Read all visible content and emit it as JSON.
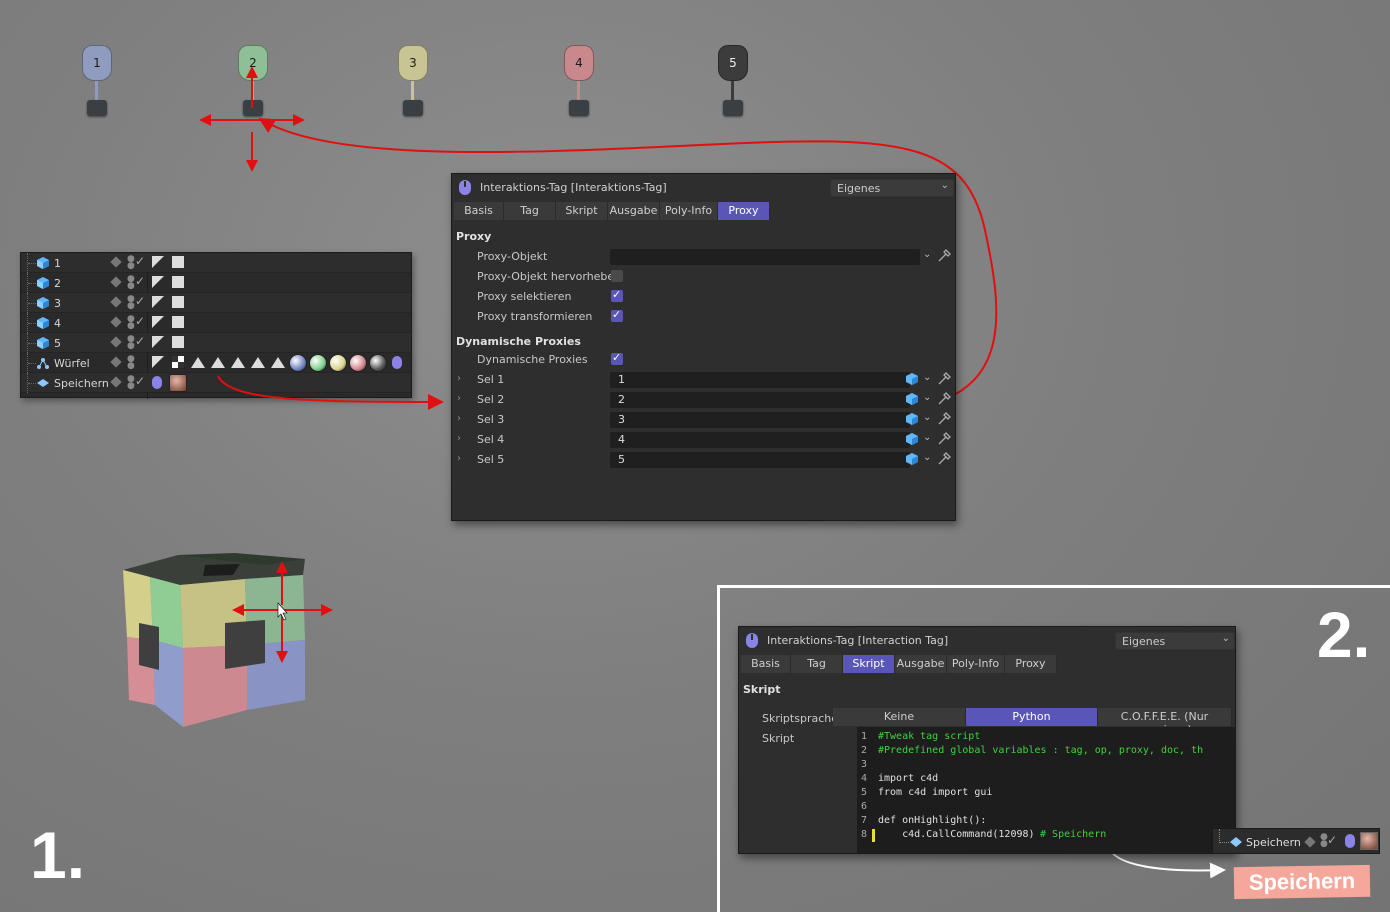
{
  "markers": [
    {
      "label": "1",
      "color": "#8f9cbf"
    },
    {
      "label": "2",
      "color": "#8fbf97"
    },
    {
      "label": "3",
      "color": "#c9c494"
    },
    {
      "label": "4",
      "color": "#c8888c"
    },
    {
      "label": "5",
      "color": "#3c3c3c"
    }
  ],
  "object_manager": {
    "rows": [
      {
        "name": "1"
      },
      {
        "name": "2"
      },
      {
        "name": "3"
      },
      {
        "name": "4"
      },
      {
        "name": "5"
      },
      {
        "name": "Würfel"
      },
      {
        "name": "Speichern"
      }
    ]
  },
  "panel1": {
    "title": "Interaktions-Tag [Interaktions-Tag]",
    "mode": "Eigenes",
    "tabs": [
      "Basis",
      "Tag",
      "Skript",
      "Ausgabe",
      "Poly-Info",
      "Proxy"
    ],
    "active_tab": "Proxy",
    "section_proxy": "Proxy",
    "proxy_object_label": "Proxy-Objekt",
    "proxy_highlight_label": "Proxy-Objekt hervorheben",
    "proxy_select_label": "Proxy selektieren",
    "proxy_transform_label": "Proxy transformieren",
    "section_dynamic": "Dynamische Proxies",
    "dynamic_label": "Dynamische Proxies",
    "selections": [
      {
        "label": "Sel 1",
        "value": "1"
      },
      {
        "label": "Sel 2",
        "value": "2"
      },
      {
        "label": "Sel 3",
        "value": "3"
      },
      {
        "label": "Sel 4",
        "value": "4"
      },
      {
        "label": "Sel 5",
        "value": "5"
      }
    ]
  },
  "panel2": {
    "title": "Interaktions-Tag [Interaction Tag]",
    "mode": "Eigenes",
    "tabs": [
      "Basis",
      "Tag",
      "Skript",
      "Ausgabe",
      "Poly-Info",
      "Proxy"
    ],
    "active_tab": "Skript",
    "section": "Skript",
    "lang_label": "Skriptsprache",
    "lang_options": [
      "Keine",
      "Python",
      "C.O.F.F.E.E. (Nur anzeigen)"
    ],
    "lang_selected": "Python",
    "script_label": "Skript",
    "code": [
      {
        "n": "1",
        "text": "#Tweak tag script",
        "kind": "comment"
      },
      {
        "n": "2",
        "text": "#Predefined global variables : tag, op, proxy, doc, th",
        "kind": "comment"
      },
      {
        "n": "3",
        "text": "",
        "kind": "code"
      },
      {
        "n": "4",
        "text": "import c4d",
        "kind": "code"
      },
      {
        "n": "5",
        "text": "from c4d import gui",
        "kind": "code"
      },
      {
        "n": "6",
        "text": "",
        "kind": "code"
      },
      {
        "n": "7",
        "text": "def onHighlight():",
        "kind": "code"
      },
      {
        "n": "8",
        "text": "    c4d.CallCommand(12098)",
        "comment": " # Speichern",
        "kind": "code"
      }
    ]
  },
  "speichern_row": {
    "name": "Speichern"
  },
  "speichern_badge": "Speichern",
  "step_labels": {
    "one": "1.",
    "two": "2."
  },
  "colors": {
    "accent": "#5a56b8",
    "red": "#e01010",
    "badge": "#f4a79a"
  }
}
